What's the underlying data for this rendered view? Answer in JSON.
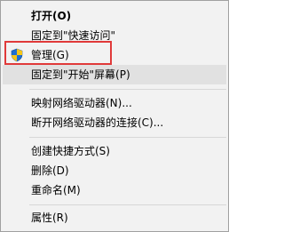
{
  "context_menu": {
    "items": [
      {
        "label": "打开(O)"
      },
      {
        "label": "固定到\"快速访问\""
      },
      {
        "label": "管理(G)",
        "icon": "uac-shield-icon"
      },
      {
        "label": "固定到\"开始\"屏幕(P)"
      },
      {
        "label": "映射网络驱动器(N)..."
      },
      {
        "label": "断开网络驱动器的连接(C)..."
      },
      {
        "label": "创建快捷方式(S)"
      },
      {
        "label": "删除(D)"
      },
      {
        "label": "重命名(M)"
      },
      {
        "label": "属性(R)"
      }
    ],
    "highlight_color": "#e03a3a",
    "hover_color": "#e1e1e1"
  }
}
